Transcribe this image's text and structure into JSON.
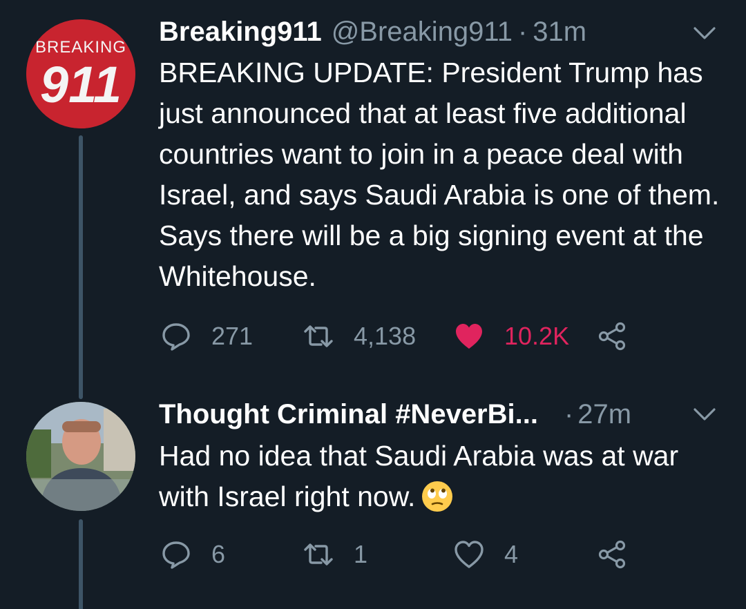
{
  "tweets": [
    {
      "display_name": "Breaking911",
      "handle": "@Breaking911",
      "separator": "·",
      "time": "31m",
      "avatar_logo_text": [
        "BREAKING",
        "911"
      ],
      "body": "BREAKING UPDATE: President Trump has just announced that at least five additional countries want to join in a peace deal with Israel, and says Saudi Arabia is one of them. Says there will be a big signing event at the Whitehouse.",
      "replies": "271",
      "retweets": "4,138",
      "likes": "10.2K",
      "liked": true
    },
    {
      "display_name": "Thought Criminal #NeverBi...",
      "separator": "·",
      "time": "27m",
      "body": "Had no idea that Saudi Arabia was at war with Israel right now.",
      "emoji": "face-with-rolling-eyes",
      "replies": "6",
      "retweets": "1",
      "likes": "4",
      "liked": false
    }
  ],
  "colors": {
    "background": "#141d26",
    "text": "#ffffff",
    "secondary": "#8899a6",
    "like": "#e0245e",
    "thread_line": "#3d5466"
  }
}
